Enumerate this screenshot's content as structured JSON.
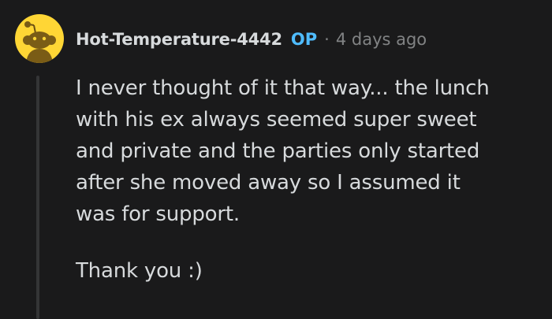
{
  "comment": {
    "username": "Hot-Temperature-4442",
    "op_label": "OP",
    "separator": "·",
    "timestamp": "4 days ago",
    "avatar_icon": "snoo-avatar-icon",
    "paragraphs": [
      "I never thought of it that way... the lunch\nwith his ex always seemed super sweet\nand private and the parties only started\nafter she moved away so I assumed it\nwas for support.",
      "Thank you :)"
    ]
  },
  "colors": {
    "background": "#1a1a1b",
    "text": "#d7dadc",
    "muted": "#818384",
    "op_accent": "#4fbcff",
    "avatar_bg": "#ffd635",
    "thread_line": "#343536"
  }
}
